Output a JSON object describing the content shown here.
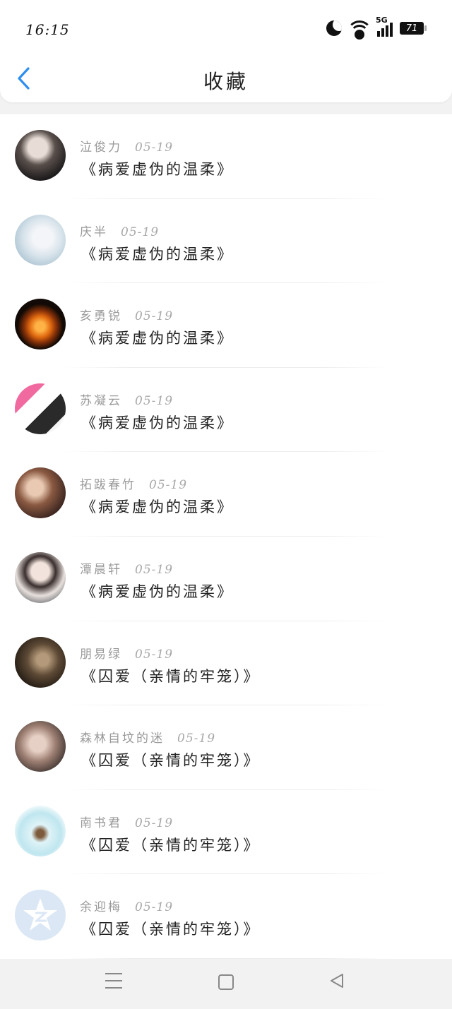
{
  "status_bar": {
    "time": "16:15",
    "network": "5G",
    "battery": "71",
    "icons": [
      "moon-icon",
      "wifi-icon",
      "signal-icon",
      "battery-icon"
    ]
  },
  "header": {
    "title": "收藏",
    "back_icon": "chevron-left-icon",
    "accent_color": "#2d8ff0"
  },
  "favorites": [
    {
      "name": "泣俊力",
      "date": "05-19",
      "work": "《病爱虚伪的温柔》",
      "avatar": "dark-portrait"
    },
    {
      "name": "庆半",
      "date": "05-19",
      "work": "《病爱虚伪的温柔》",
      "avatar": "light-blurred"
    },
    {
      "name": "亥勇锐",
      "date": "05-19",
      "work": "《病爱虚伪的温柔》",
      "avatar": "pumpkin"
    },
    {
      "name": "苏凝云",
      "date": "05-19",
      "work": "《病爱虚伪的温柔》",
      "avatar": "manga-pink"
    },
    {
      "name": "拓跋春竹",
      "date": "05-19",
      "work": "《病爱虚伪的温柔》",
      "avatar": "warm-portrait"
    },
    {
      "name": "潭晨轩",
      "date": "05-19",
      "work": "《病爱虚伪的温柔》",
      "avatar": "girl-portrait"
    },
    {
      "name": "朋易绿",
      "date": "05-19",
      "work": "《囚爱（亲情的牢笼）》",
      "avatar": "couple-dark"
    },
    {
      "name": "森林自坟的迷",
      "date": "05-19",
      "work": "《囚爱（亲情的牢笼）》",
      "avatar": "sitting-person"
    },
    {
      "name": "南书君",
      "date": "05-19",
      "work": "《囚爱（亲情的牢笼）》",
      "avatar": "jar"
    },
    {
      "name": "余迎梅",
      "date": "05-19",
      "work": "《囚爱（亲情的牢笼）》",
      "avatar": "default-star"
    }
  ],
  "nav_bar": {
    "icons": [
      "menu-icon",
      "home-square-icon",
      "back-triangle-icon"
    ]
  }
}
